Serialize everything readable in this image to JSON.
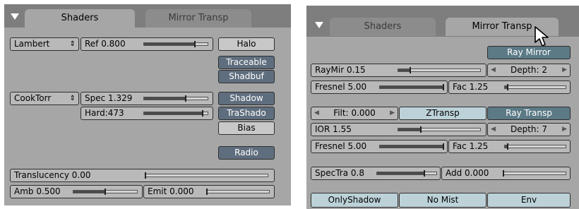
{
  "left_panel": {
    "tabs": {
      "shaders": "Shaders",
      "mirror_transp": "Mirror Transp"
    },
    "diffuse_shader": "Lambert",
    "ref": {
      "label": "Ref  0.800",
      "value": 0.8
    },
    "specular_shader": "CookTorr",
    "spec": {
      "label": "Spec 1.329",
      "value": 0.66
    },
    "hard": {
      "label": "Hard:473",
      "value": 0.92
    },
    "toggles": {
      "halo": "Halo",
      "traceable": "Traceable",
      "shadbuf": "Shadbuf",
      "shadow": "Shadow",
      "trashado": "TraShado",
      "bias": "Bias",
      "radio": "Radio"
    },
    "translucency": {
      "label": "Translucency 0.00",
      "value": 0.0
    },
    "amb": {
      "label": "Amb 0.500",
      "value": 0.5
    },
    "emit": {
      "label": "Emit 0.000",
      "value": 0.0
    }
  },
  "right_panel": {
    "tabs": {
      "shaders": "Shaders",
      "mirror_transp": "Mirror Transp"
    },
    "ray_mirror": "Ray Mirror",
    "raymir": {
      "label": "RayMir 0.15",
      "value": 0.15
    },
    "mir_depth": "Depth: 2",
    "mir_fresnel": {
      "label": "Fresnel 5.00",
      "value": 1.0
    },
    "mir_fac": {
      "label": "Fac 1.25",
      "value": 0.05
    },
    "filt": "Filt: 0.000",
    "ztransp": "ZTransp",
    "ray_transp": "Ray Transp",
    "ior": {
      "label": "IOR 1.55",
      "value": 0.28
    },
    "transp_depth": "Depth: 7",
    "transp_fresnel": {
      "label": "Fresnel 5.00",
      "value": 1.0
    },
    "transp_fac": {
      "label": "Fac 1.25",
      "value": 0.05
    },
    "spectra": {
      "label": "SpecTra 0.8",
      "value": 0.8
    },
    "add": {
      "label": "Add 0.000",
      "value": 0.0
    },
    "onlyshadow": "OnlyShadow",
    "no_mist": "No Mist",
    "env": "Env"
  }
}
